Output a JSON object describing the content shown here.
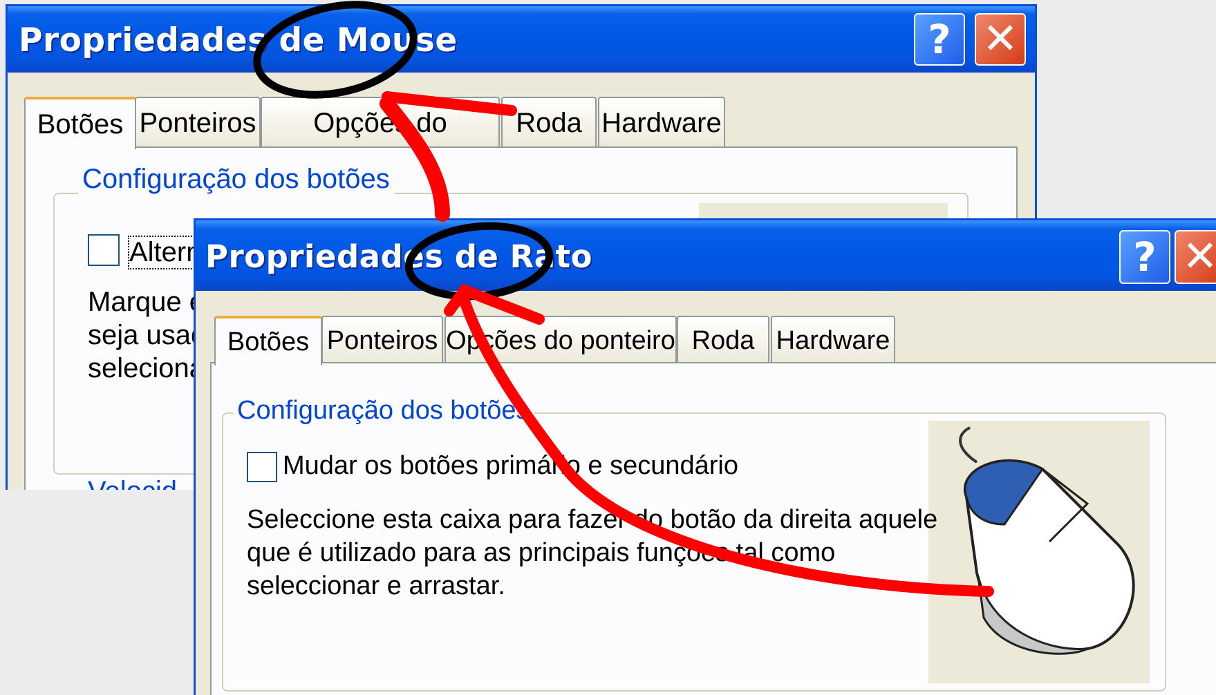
{
  "dialog_back": {
    "title": "Propriedades de Mouse",
    "help_label": "?",
    "close_label": "✕",
    "tabs": [
      {
        "label": "Botões"
      },
      {
        "label": "Ponteiros"
      },
      {
        "label": "Opções do ponteiro"
      },
      {
        "label": "Roda"
      },
      {
        "label": "Hardware"
      }
    ],
    "group_title": "Configuração dos botões",
    "checkbox_label": "Alternar",
    "description": [
      "Marque e",
      "seja usad",
      "selecionar"
    ],
    "bottom_link": "Velocid"
  },
  "dialog_front": {
    "title": "Propriedades de Rato",
    "help_label": "?",
    "close_label": "✕",
    "tabs": [
      {
        "label": "Botões"
      },
      {
        "label": "Ponteiros"
      },
      {
        "label": "Opções do ponteiro"
      },
      {
        "label": "Roda"
      },
      {
        "label": "Hardware"
      }
    ],
    "group_title": "Configuração dos botões",
    "checkbox_label": "Mudar os botões primário e secundário",
    "description": [
      "Seleccione esta caixa para fazer do botão da direita aquele",
      "que é utilizado para as principais funções tal como",
      "seleccionar e arrastar."
    ]
  },
  "colors": {
    "titlebar": "#0058e6",
    "window_bg": "#ece9d8",
    "group_title": "#0046d5",
    "active_tab_accent": "#f2a93b",
    "annotation_red": "#ff0000",
    "annotation_black": "#000000",
    "mouse_button_blue": "#2f5fb3"
  },
  "icons": [
    "help-icon",
    "close-icon",
    "mouse-illustration"
  ]
}
